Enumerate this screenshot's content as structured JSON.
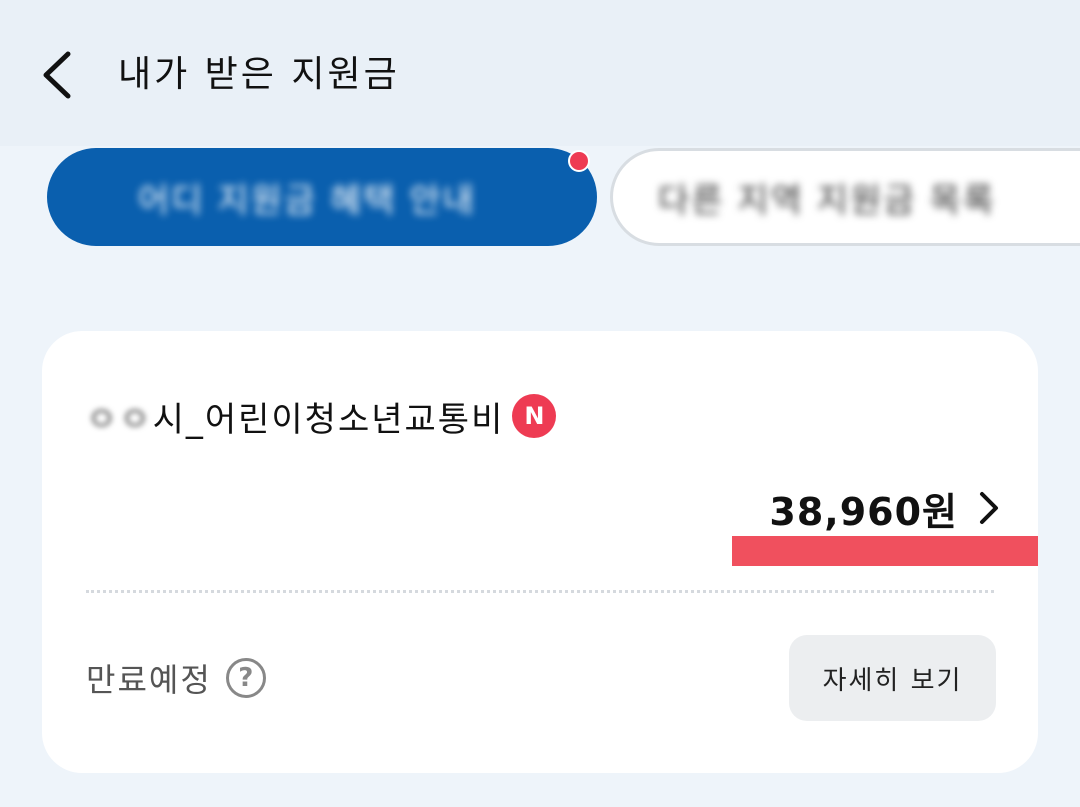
{
  "header": {
    "title": "내가 받은 지원금",
    "back_icon": "chevron-left-icon"
  },
  "tabs": [
    {
      "label": "어디 지원금 혜택 안내",
      "active": true,
      "has_notification_dot": true
    },
    {
      "label": "다른 지역 지원금 목록",
      "active": false
    }
  ],
  "card": {
    "title_prefix": "ㅇㅇ",
    "title": "시_어린이청소년교통비",
    "new_badge": "N",
    "amount": "38,960원",
    "expiry_label": "만료예정",
    "help_symbol": "?",
    "detail_button_label": "자세히 보기"
  },
  "colors": {
    "active_tab": "#0a5fae",
    "notification": "#ee3b53",
    "redaction": "#f0505e",
    "background": "#eef4fa"
  }
}
